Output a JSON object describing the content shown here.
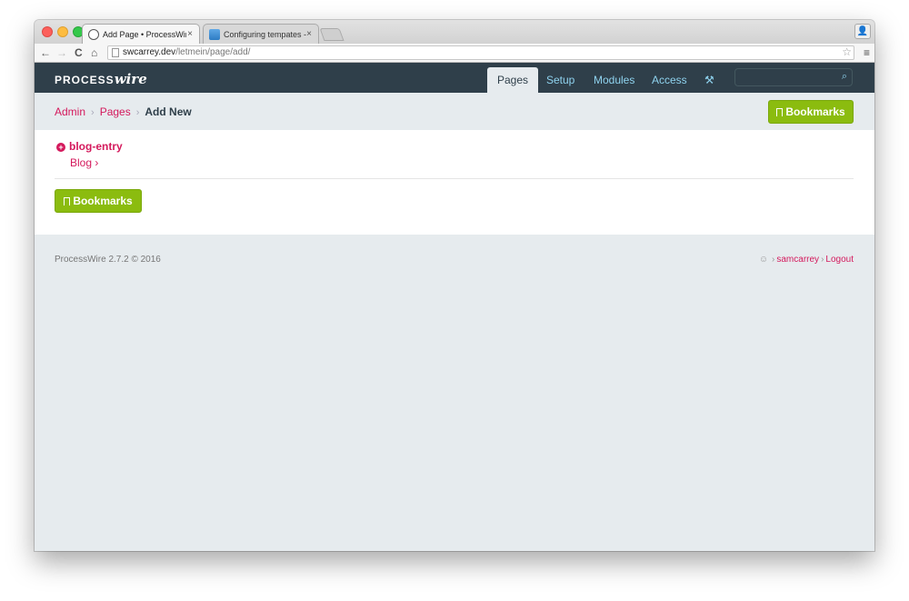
{
  "browser": {
    "tabs": [
      {
        "title": "Add Page • ProcessWire •",
        "close": "×",
        "active": true
      },
      {
        "title": "Configuring tempates - fan",
        "close": "×",
        "active": false
      }
    ],
    "nav": {
      "back": "←",
      "forward": "→",
      "reload": "C",
      "home": "⌂"
    },
    "url": {
      "host": "swcarrey.dev",
      "path": "/letmein/page/add/"
    },
    "star": "☆",
    "menu": "≡",
    "profile": "👤"
  },
  "masthead": {
    "logo_main": "PROCESS",
    "logo_accent": "wire",
    "nav": [
      {
        "label": "Pages",
        "active": true
      },
      {
        "label": "Setup",
        "active": false
      },
      {
        "label": "Modules",
        "active": false
      },
      {
        "label": "Access",
        "active": false
      }
    ],
    "wrench": "🔧",
    "search_placeholder": "",
    "search_glyph": "⚲"
  },
  "breadcrumb": {
    "items": [
      "Admin",
      "Pages"
    ],
    "separator": "›",
    "current": "Add New"
  },
  "bookmarks_label": "Bookmarks",
  "content": {
    "template": "blog-entry",
    "parent": "Blog",
    "parent_chevron": "›"
  },
  "footer": {
    "version": "ProcessWire 2.7.2 © 2016",
    "user": "samcarrey",
    "logout": "Logout",
    "separator": "›"
  },
  "colors": {
    "masthead": "#2f3f4a",
    "link": "#d4195c",
    "nav_link": "#8fd3ef",
    "button": "#8bbc0f",
    "background": "#e6ebee"
  }
}
